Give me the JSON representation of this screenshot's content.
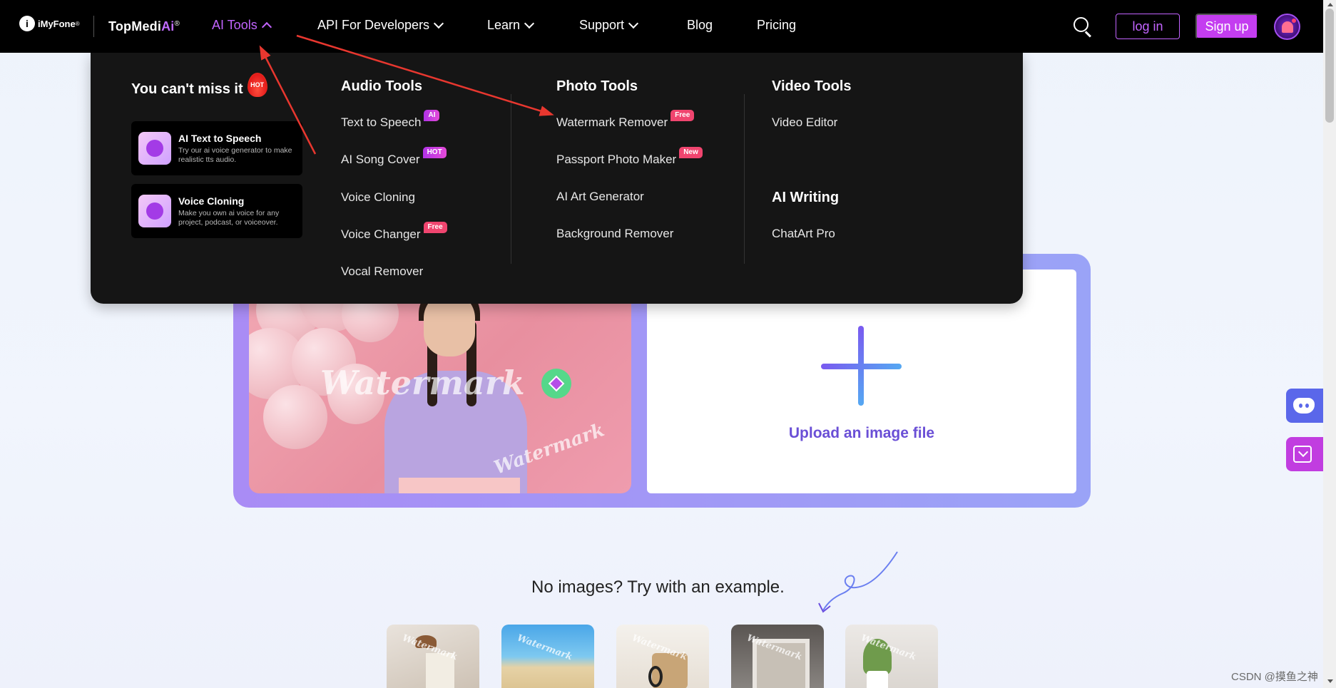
{
  "navbar": {
    "brand": "iMyFone",
    "brand_reg": "®",
    "product_prefix": "TopMedi",
    "product_ai": "Ai",
    "product_reg": "®",
    "items": [
      {
        "label": "AI Tools",
        "active": true
      },
      {
        "label": "API For Developers"
      },
      {
        "label": "Learn"
      },
      {
        "label": "Support"
      },
      {
        "label": "Blog"
      },
      {
        "label": "Pricing"
      }
    ],
    "login_label": "log in",
    "signup_label": "Sign up"
  },
  "mega_menu": {
    "promo": {
      "title": "You can't miss it",
      "hot_badge": "HOT",
      "cards": [
        {
          "title": "AI Text to Speech",
          "desc": "Try our ai voice generator to make realistic tts audio."
        },
        {
          "title": "Voice Cloning",
          "desc": "Make you own ai voice for any project, podcast, or voiceover."
        }
      ]
    },
    "audio": {
      "title": "Audio Tools",
      "items": [
        {
          "label": "Text to Speech",
          "badge": "AI"
        },
        {
          "label": "AI Song Cover",
          "badge": "HOT"
        },
        {
          "label": "Voice Cloning",
          "badge": ""
        },
        {
          "label": "Voice Changer",
          "badge": "Free"
        },
        {
          "label": "Vocal Remover",
          "badge": ""
        }
      ]
    },
    "photo": {
      "title": "Photo Tools",
      "items": [
        {
          "label": "Watermark Remover",
          "badge": "Free"
        },
        {
          "label": "Passport Photo Maker",
          "badge": "New"
        },
        {
          "label": "AI Art Generator",
          "badge": ""
        },
        {
          "label": "Background Remover",
          "badge": ""
        }
      ]
    },
    "video": {
      "title": "Video Tools",
      "items": [
        {
          "label": "Video Editor"
        }
      ]
    },
    "writing": {
      "title": "AI Writing",
      "items": [
        {
          "label": "ChatArt Pro"
        }
      ]
    }
  },
  "upload": {
    "sample_watermark_main": "Watermark",
    "sample_watermark_small": "Watermark",
    "label": "Upload an image file"
  },
  "examples": {
    "title": "No images? Try with an example.",
    "thumb_watermark": "Watermark"
  },
  "credit": "CSDN @摸鱼之神",
  "colors": {
    "accent": "#c264ff",
    "signup_bg": "#c43df0",
    "upload_frame": "#a98cf5",
    "discord": "#5a67ea",
    "download": "#c13de0",
    "annotation_arrow": "#e8372f"
  }
}
